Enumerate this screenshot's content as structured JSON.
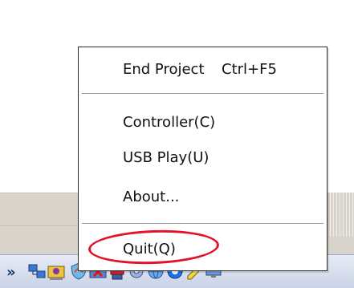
{
  "menu": {
    "items": [
      {
        "label": "End Project",
        "shortcut": "Ctrl+F5"
      },
      {
        "label": "Controller(C)"
      },
      {
        "label": "USB Play(U)"
      },
      {
        "label": "About..."
      },
      {
        "label": "Quit(Q)"
      }
    ]
  },
  "taskbar": {
    "chevron": "»",
    "tray_icons": [
      "network-icon",
      "user-monitor-icon",
      "shield-icon",
      "red-x-icon",
      "red-flag-icon",
      "gear-icon",
      "globe-icon",
      "blue-circle-icon",
      "pencil-icon",
      "monitor-icon"
    ]
  },
  "colors": {
    "highlight": "#e3122a",
    "taskbar": "#d7deec",
    "menu_border": "#2d2d2d"
  }
}
